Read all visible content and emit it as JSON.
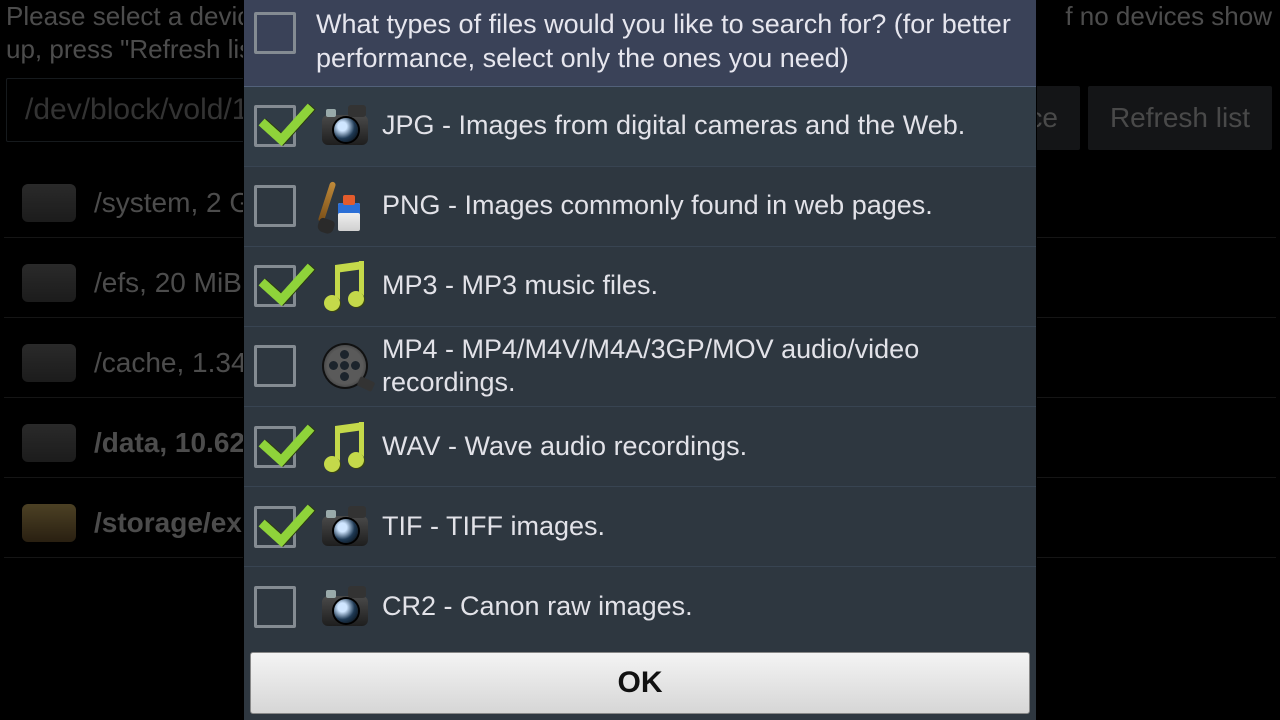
{
  "background": {
    "instructions_line1": "Please select a device",
    "instructions_line2": "up, press \"Refresh lis",
    "instructions_tail": "f no devices show",
    "path_value": "/dev/block/vold/1",
    "btn_device_tail": "vice",
    "btn_refresh": "Refresh list",
    "rows": [
      {
        "label": "/system, 2 G"
      },
      {
        "label": "/efs, 20 MiB"
      },
      {
        "label": "/cache, 1.34"
      },
      {
        "label": "/data, 10.62"
      },
      {
        "label": "/storage/ex"
      }
    ]
  },
  "dialog": {
    "header": {
      "checked": false,
      "text": "What types of files would you like to search for? (for better performance, select only the ones you need)"
    },
    "items": [
      {
        "checked": true,
        "icon": "cam",
        "label": "JPG - Images from digital cameras and the Web."
      },
      {
        "checked": false,
        "icon": "paint",
        "label": "PNG - Images commonly found in web pages."
      },
      {
        "checked": true,
        "icon": "note",
        "label": "MP3 - MP3 music files."
      },
      {
        "checked": false,
        "icon": "reel",
        "label": "MP4 - MP4/M4V/M4A/3GP/MOV audio/video recordings."
      },
      {
        "checked": true,
        "icon": "note",
        "label": "WAV - Wave audio recordings."
      },
      {
        "checked": true,
        "icon": "cam",
        "label": "TIF - TIFF images."
      },
      {
        "checked": false,
        "icon": "cam",
        "label": "CR2 - Canon raw images."
      }
    ],
    "ok_label": "OK"
  }
}
